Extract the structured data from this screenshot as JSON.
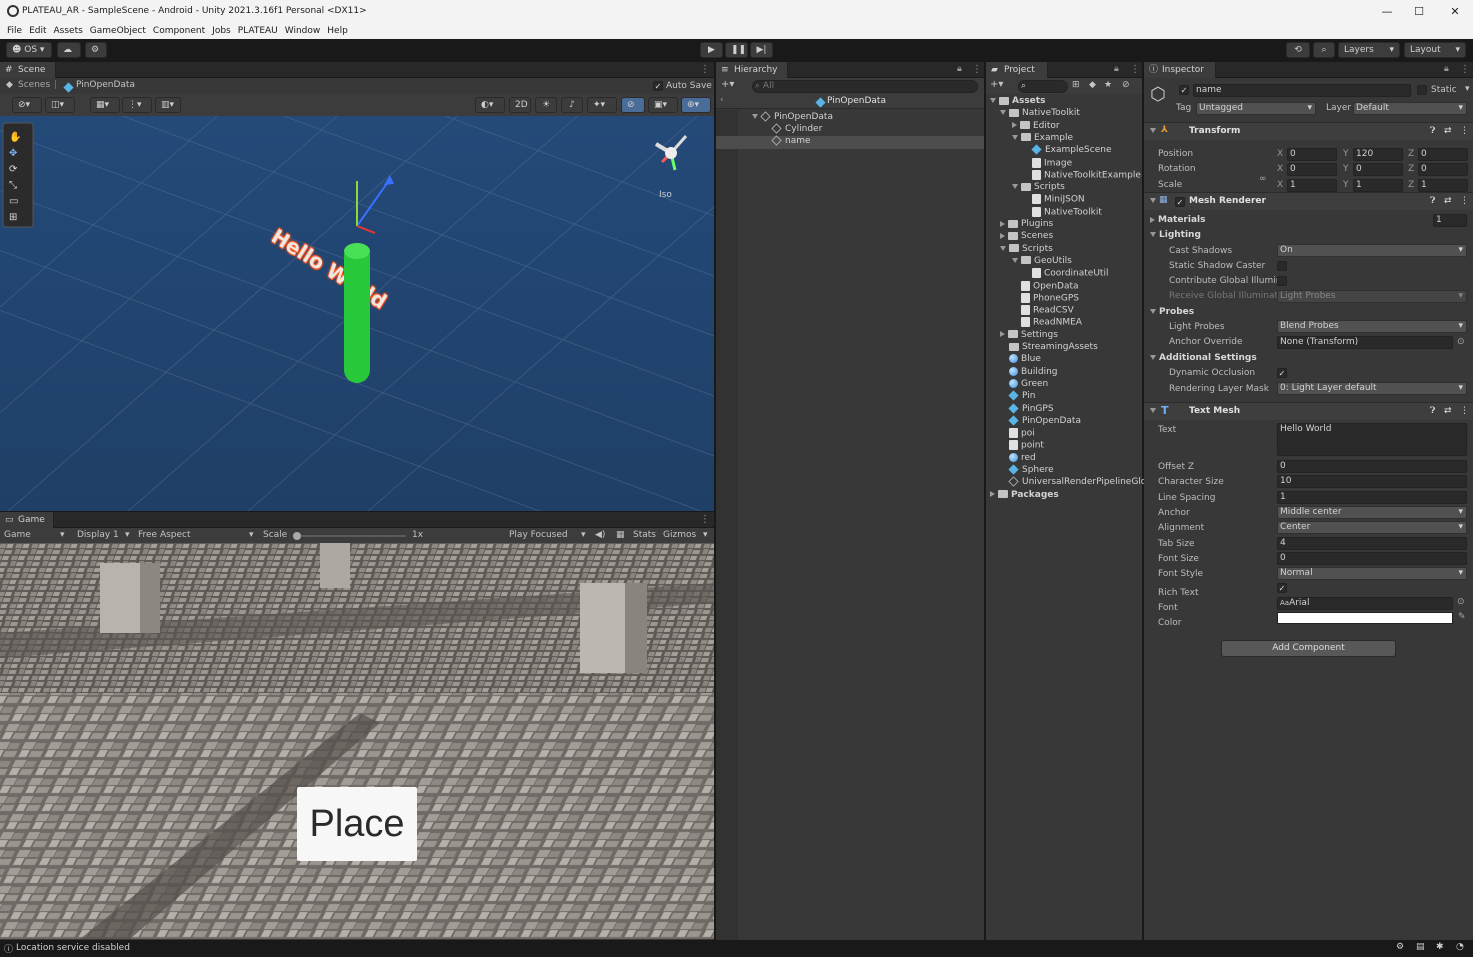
{
  "window": {
    "title": "PLATEAU_AR - SampleScene - Android - Unity 2021.3.16f1 Personal <DX11>",
    "minimize": "—",
    "maximize": "☐",
    "close": "✕"
  },
  "menu": [
    "File",
    "Edit",
    "Assets",
    "GameObject",
    "Component",
    "Jobs",
    "PLATEAU",
    "Window",
    "Help"
  ],
  "toolbar": {
    "account": "OS",
    "layers": "Layers",
    "layout": "Layout"
  },
  "scene": {
    "tab": "Scene",
    "breadcrumb_root": "Scenes",
    "breadcrumb_obj": "PinOpenData",
    "autosave": "Auto Save",
    "mode_2d": "2D",
    "iso": "Iso",
    "text3d": "Hello World"
  },
  "game": {
    "tab": "Game",
    "mode": "Game",
    "display": "Display 1",
    "aspect": "Free Aspect",
    "scale_label": "Scale",
    "scale_value": "1x",
    "play": "Play Focused",
    "stats": "Stats",
    "gizmos": "Gizmos",
    "place_button": "Place"
  },
  "hierarchy": {
    "tab": "Hierarchy",
    "search": "All",
    "scene": "PinOpenData",
    "items": [
      "PinOpenData",
      "Cylinder",
      "name"
    ]
  },
  "project": {
    "tab": "Project",
    "items": [
      {
        "l": "Assets",
        "d": 0,
        "t": "folder",
        "f": "open"
      },
      {
        "l": "NativeToolkit",
        "d": 1,
        "t": "folder",
        "f": "open"
      },
      {
        "l": "Editor",
        "d": 2,
        "t": "folder",
        "f": "closed"
      },
      {
        "l": "Example",
        "d": 2,
        "t": "folder",
        "f": "open"
      },
      {
        "l": "ExampleScene",
        "d": 3,
        "t": "scene",
        "f": ""
      },
      {
        "l": "Image",
        "d": 3,
        "t": "image",
        "f": ""
      },
      {
        "l": "NativeToolkitExample",
        "d": 3,
        "t": "cs",
        "f": ""
      },
      {
        "l": "Scripts",
        "d": 2,
        "t": "folder",
        "f": "open"
      },
      {
        "l": "MiniJSON",
        "d": 3,
        "t": "cs",
        "f": ""
      },
      {
        "l": "NativeToolkit",
        "d": 3,
        "t": "cs",
        "f": ""
      },
      {
        "l": "Plugins",
        "d": 1,
        "t": "folder",
        "f": "closed"
      },
      {
        "l": "Scenes",
        "d": 1,
        "t": "folder",
        "f": "closed"
      },
      {
        "l": "Scripts",
        "d": 1,
        "t": "folder",
        "f": "open"
      },
      {
        "l": "GeoUtils",
        "d": 2,
        "t": "folder",
        "f": "open"
      },
      {
        "l": "CoordinateUtil",
        "d": 3,
        "t": "cs",
        "f": ""
      },
      {
        "l": "OpenData",
        "d": 2,
        "t": "cs",
        "f": ""
      },
      {
        "l": "PhoneGPS",
        "d": 2,
        "t": "cs",
        "f": ""
      },
      {
        "l": "ReadCSV",
        "d": 2,
        "t": "cs",
        "f": ""
      },
      {
        "l": "ReadNMEA",
        "d": 2,
        "t": "cs",
        "f": ""
      },
      {
        "l": "Settings",
        "d": 1,
        "t": "folder",
        "f": "closed"
      },
      {
        "l": "StreamingAssets",
        "d": 1,
        "t": "folder",
        "f": ""
      },
      {
        "l": "Blue",
        "d": 1,
        "t": "mat",
        "f": ""
      },
      {
        "l": "Building",
        "d": 1,
        "t": "mat",
        "f": ""
      },
      {
        "l": "Green",
        "d": 1,
        "t": "mat",
        "f": ""
      },
      {
        "l": "Pin",
        "d": 1,
        "t": "prefab",
        "f": ""
      },
      {
        "l": "PinGPS",
        "d": 1,
        "t": "prefab",
        "f": ""
      },
      {
        "l": "PinOpenData",
        "d": 1,
        "t": "prefab",
        "f": ""
      },
      {
        "l": "poi",
        "d": 1,
        "t": "cs",
        "f": ""
      },
      {
        "l": "point",
        "d": 1,
        "t": "cs",
        "f": ""
      },
      {
        "l": "red",
        "d": 1,
        "t": "mat",
        "f": ""
      },
      {
        "l": "Sphere",
        "d": 1,
        "t": "prefab",
        "f": ""
      },
      {
        "l": "UniversalRenderPipelineGlo",
        "d": 1,
        "t": "asset",
        "f": ""
      },
      {
        "l": "Packages",
        "d": 0,
        "t": "folder",
        "f": "closed"
      }
    ]
  },
  "inspector": {
    "tab": "Inspector",
    "name": "name",
    "static": "Static",
    "tag_label": "Tag",
    "tag": "Untagged",
    "layer_label": "Layer",
    "layer": "Default",
    "transform": {
      "title": "Transform",
      "position": "Position",
      "rotation": "Rotation",
      "scale": "Scale",
      "pos": [
        "0",
        "120",
        "0"
      ],
      "rot": [
        "0",
        "0",
        "0"
      ],
      "scl": [
        "1",
        "1",
        "1"
      ],
      "axes": [
        "X",
        "Y",
        "Z"
      ]
    },
    "mesh": {
      "title": "Mesh Renderer",
      "materials": "Materials",
      "materials_count": "1",
      "lighting": "Lighting",
      "cast_shadows": "Cast Shadows",
      "cast_shadows_val": "On",
      "static_shadow": "Static Shadow Caster",
      "contrib_gi": "Contribute Global Illumin",
      "receive_gi": "Receive Global Illuminati",
      "receive_gi_val": "Light Probes",
      "probes": "Probes",
      "light_probes": "Light Probes",
      "light_probes_val": "Blend Probes",
      "anchor_override": "Anchor Override",
      "anchor_override_val": "None (Transform)",
      "additional": "Additional Settings",
      "dynamic_occ": "Dynamic Occlusion",
      "rendering_layer": "Rendering Layer Mask",
      "rendering_layer_val": "0: Light Layer default"
    },
    "textmesh": {
      "title": "Text Mesh",
      "text": "Text",
      "text_val": "Hello World",
      "offset_z": "Offset Z",
      "offset_z_val": "0",
      "char_size": "Character Size",
      "char_size_val": "10",
      "line_spacing": "Line Spacing",
      "line_spacing_val": "1",
      "anchor": "Anchor",
      "anchor_val": "Middle center",
      "alignment": "Alignment",
      "alignment_val": "Center",
      "tab_size": "Tab Size",
      "tab_size_val": "4",
      "font_size": "Font Size",
      "font_size_val": "0",
      "font_style": "Font Style",
      "font_style_val": "Normal",
      "rich_text": "Rich Text",
      "font": "Font",
      "font_val": "Arial",
      "color": "Color"
    },
    "add_component": "Add Component"
  },
  "status": {
    "message": "Location service disabled"
  }
}
